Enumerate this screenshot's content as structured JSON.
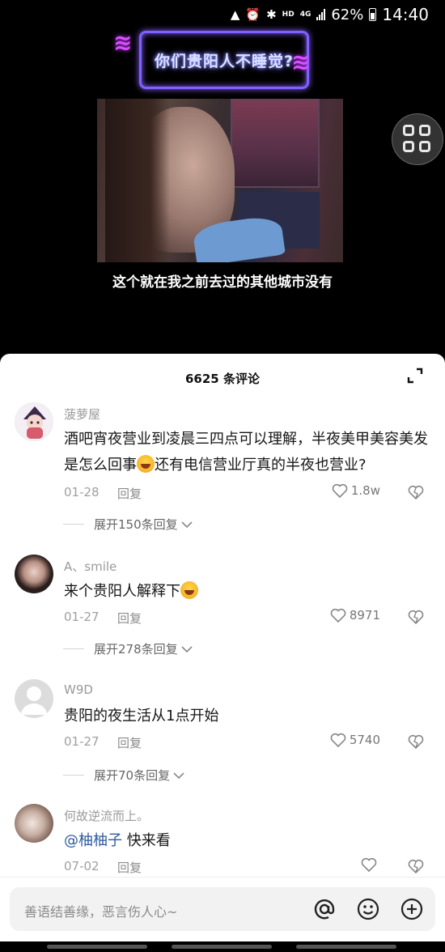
{
  "status_bar": {
    "network": "HD",
    "network_gen": "4G",
    "battery": "62%",
    "time": "14:40"
  },
  "video": {
    "title": "你们贵阳人不睡觉?",
    "subtitle": "这个就在我之前去过的其他城市没有"
  },
  "comments_header": {
    "count_label": "6625 条评论"
  },
  "comments": [
    {
      "username": "菠萝屋",
      "text_before": "酒吧宵夜营业到凌晨三四点可以理解，半夜美甲美容美发是怎么回事",
      "text_after": "还有电信营业厅真的半夜也营业?",
      "date": "01-28",
      "reply_label": "回复",
      "likes": "1.8w",
      "expand_label": "展开150条回复"
    },
    {
      "username": "A、smile",
      "text_before": "来个贵阳人解释下",
      "text_after": "",
      "date": "01-27",
      "reply_label": "回复",
      "likes": "8971",
      "expand_label": "展开278条回复"
    },
    {
      "username": "W9D",
      "text_before": "贵阳的夜生活从1点开始",
      "text_after": "",
      "date": "01-27",
      "reply_label": "回复",
      "likes": "5740",
      "expand_label": "展开70条回复"
    },
    {
      "username": "何故逆流而上。",
      "mention": "@柚柚子",
      "text_before": " 快来看",
      "text_after": "",
      "date": "07-02",
      "reply_label": "回复",
      "likes": ""
    }
  ],
  "input_bar": {
    "placeholder": "善语结善缘，恶言伤人心~"
  },
  "colors": {
    "neon_border": "#7b63ff",
    "mention": "#2e5a9c",
    "sheet_bg": "#ffffff"
  }
}
